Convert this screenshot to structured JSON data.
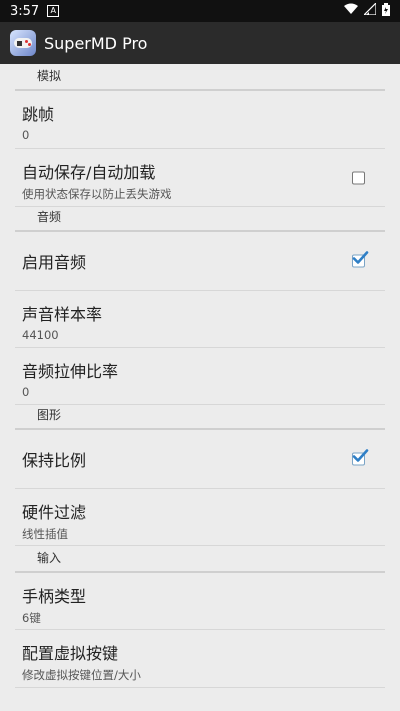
{
  "status_bar": {
    "time": "3:57"
  },
  "app": {
    "title": "SuperMD Pro"
  },
  "sections": [
    {
      "id": "simulation",
      "label": "模拟"
    },
    {
      "id": "audio",
      "label": "音频"
    },
    {
      "id": "graphics",
      "label": "图形"
    },
    {
      "id": "input",
      "label": "输入"
    }
  ],
  "items": {
    "frameskip": {
      "title": "跳帧",
      "summary": "0"
    },
    "autosave": {
      "title": "自动保存/自动加载",
      "summary": "使用状态保存以防止丢失游戏",
      "checked": false
    },
    "enable_audio": {
      "title": "启用音频",
      "checked": true
    },
    "sample_rate": {
      "title": "声音样本率",
      "summary": "44100"
    },
    "stretch": {
      "title": "音频拉伸比率",
      "summary": "0"
    },
    "keep_ratio": {
      "title": "保持比例",
      "checked": true
    },
    "hw_filter": {
      "title": "硬件过滤",
      "summary": "线性插值"
    },
    "gamepad_type": {
      "title": "手柄类型",
      "summary": "6键"
    },
    "virtual_keys": {
      "title": "配置虚拟按键",
      "summary": "修改虚拟按键位置/大小"
    }
  }
}
